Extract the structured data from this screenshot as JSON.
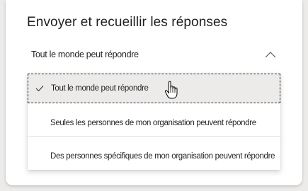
{
  "section": {
    "title": "Envoyer et recueillir les réponses"
  },
  "dropdown": {
    "selected_value": "Tout le monde peut répondre",
    "options": [
      {
        "label": "Tout le monde peut répondre",
        "selected": true
      },
      {
        "label": "Seules les personnes de mon organisation peuvent répondre",
        "selected": false
      },
      {
        "label": "Des personnes spécifiques de mon organisation peuvent répondre",
        "selected": false
      }
    ]
  },
  "icons": {
    "chevron": "chevron-up-icon",
    "check": "checkmark-icon",
    "cursor": "hand-pointer-cursor"
  },
  "colors": {
    "panel_bg": "#ffffff",
    "page_bg": "#ecebea",
    "selected_option_bg": "#edebe9",
    "text": "#252423"
  }
}
